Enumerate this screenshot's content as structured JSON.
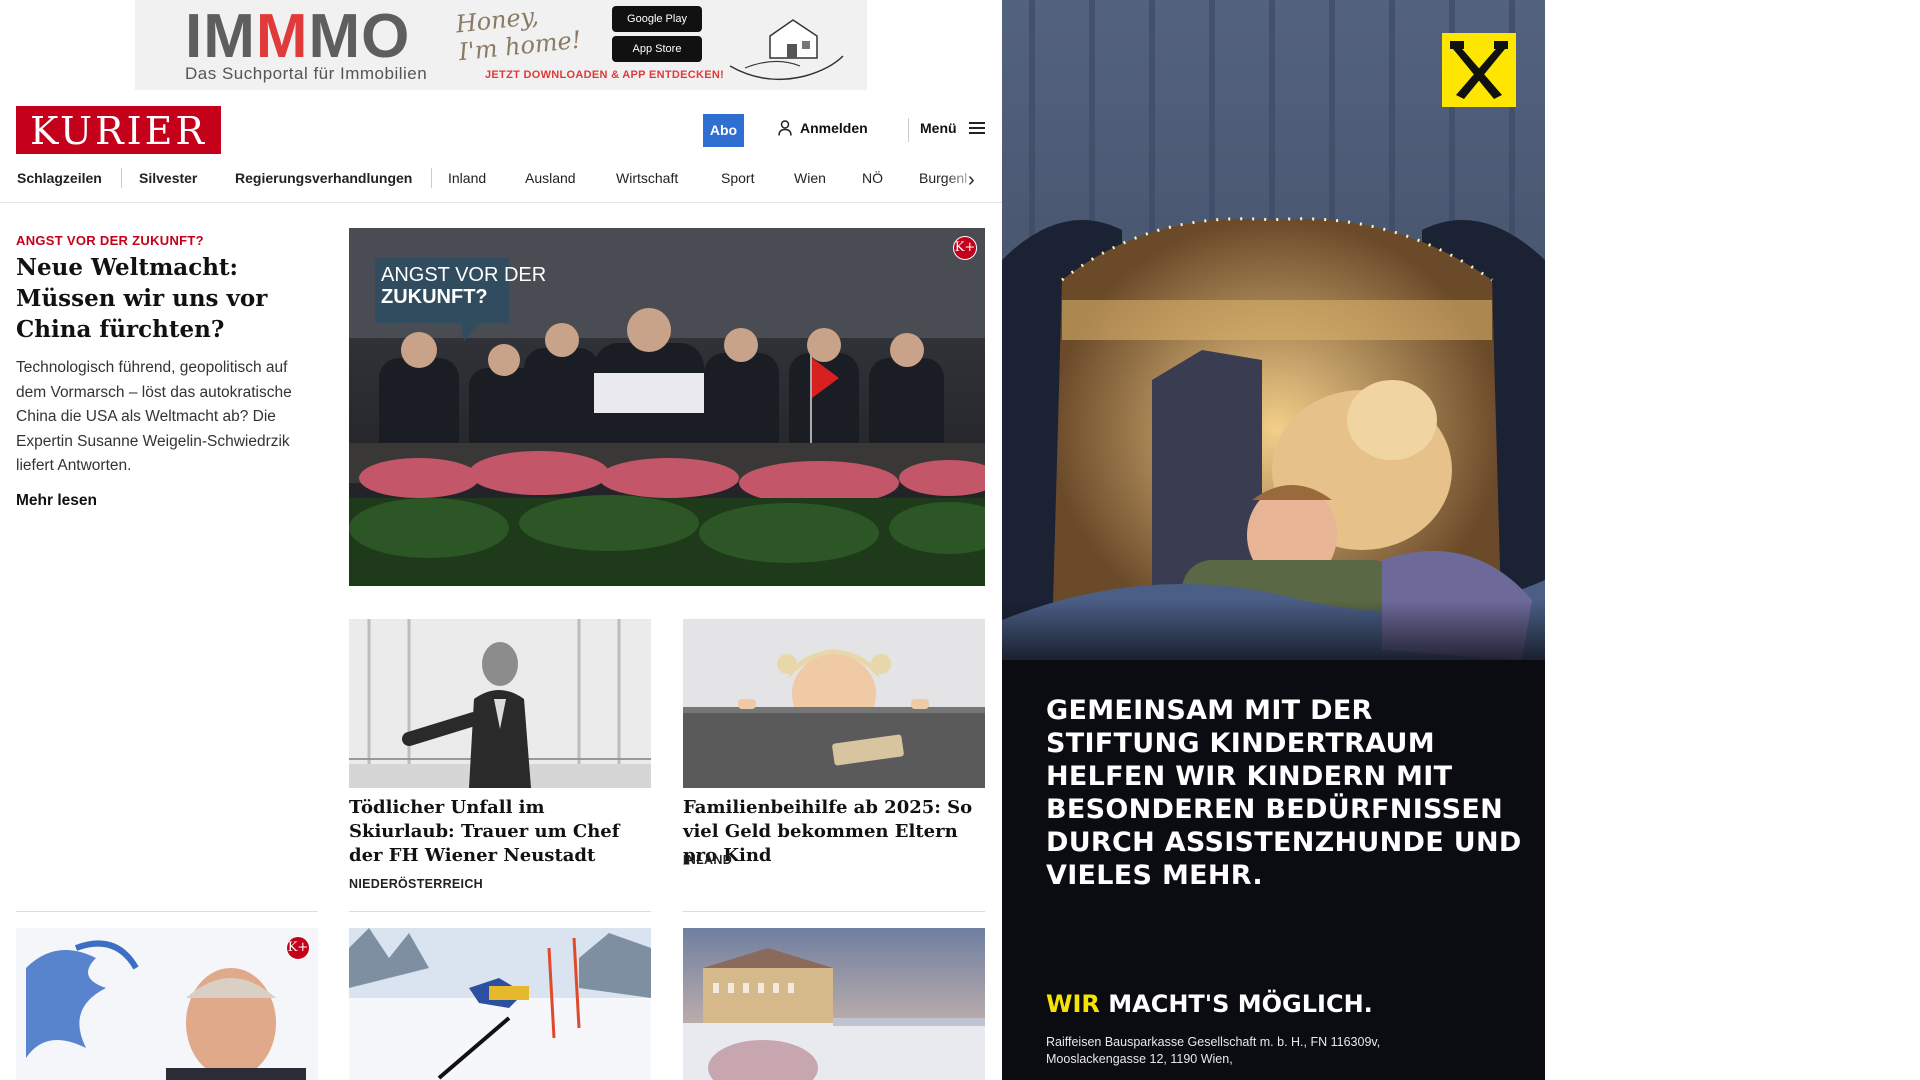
{
  "top_ad": {
    "logo_prefix": "IM",
    "logo_red": "M",
    "logo_suffix": "MO",
    "tagline": "Das Suchportal für Immobilien",
    "script_line1": "Honey,",
    "script_line2": "I'm home!",
    "google_play": "Google Play",
    "app_store": "App Store",
    "cta": "JETZT DOWNLOADEN & APP ENTDECKEN!"
  },
  "header": {
    "brand": "KURIER",
    "abo": "Abo",
    "login": "Anmelden",
    "menu": "Menü"
  },
  "nav": {
    "items": [
      "Schlagzeilen",
      "Silvester",
      "Regierungsverhandlungen",
      "Inland",
      "Ausland",
      "Wirtschaft",
      "Sport",
      "Wien",
      "NÖ",
      "Burgenl"
    ]
  },
  "lead": {
    "kicker": "ANGST VOR DER ZUKUNFT?",
    "title": "Neue Weltmacht: Müssen wir uns vor China fürchten?",
    "text": "Technologisch führend, geopolitisch auf dem Vormarsch – löst das autokratische China die USA als Weltmacht ab? Die Expertin Susanne Weigelin-Schwiedrzik liefert Antworten.",
    "more": "Mehr lesen",
    "badge_line1": "ANGST VOR DER",
    "badge_line2": "ZUKUNFT?",
    "kplus": "K+"
  },
  "cards": [
    {
      "title": "Tödlicher Unfall im Skiurlaub: Trauer um Chef der FH Wiener Neustadt",
      "category": "NIEDERÖSTERREICH"
    },
    {
      "title": "Familienbeihilfe ab 2025: So viel Geld bekommen Eltern pro Kind",
      "category": "INLAND"
    }
  ],
  "bottom_kplus": "K+",
  "right_ad": {
    "text": "GEMEINSAM MIT DER STIFTUNG KINDERTRAUM HELFEN WIR KINDERN MIT BESONDEREN BEDÜRFNISSEN DURCH ASSISTENZHUNDE UND VIELES MEHR.",
    "slogan_yellow": "WIR",
    "slogan_rest": " MACHT'S MÖGLICH.",
    "legal": "Raiffeisen Bausparkasse Gesellschaft m. b. H., FN 116309v, Mooslackengasse 12, 1190 Wien,"
  },
  "colors": {
    "brand_red": "#c4001a",
    "abo_blue": "#2f6fd1",
    "raiffeisen_yellow": "#ffe600"
  }
}
